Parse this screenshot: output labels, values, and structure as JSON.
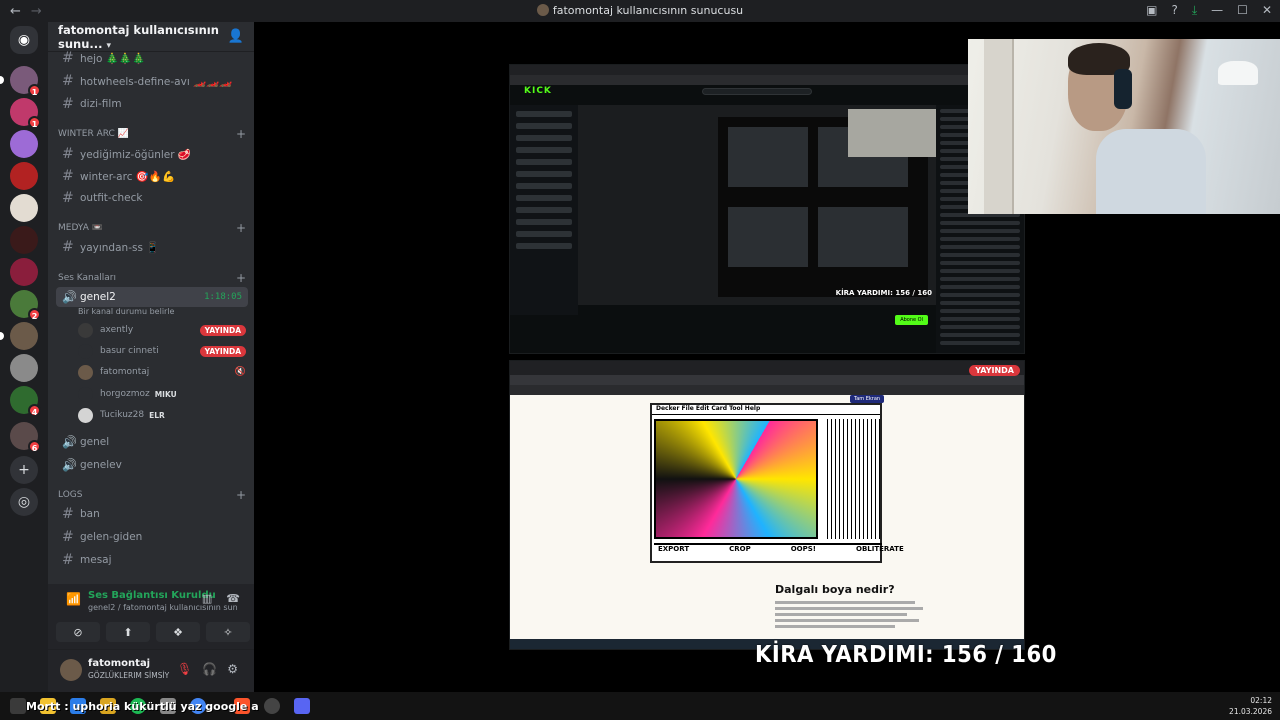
{
  "window": {
    "title": "fatomontaj kullanıcısının sunucusu"
  },
  "guild": {
    "name": "fatomontaj kullanıcısının sunu..."
  },
  "channels_top": [
    {
      "name": "hejo 🎄🎄🎄"
    },
    {
      "name": "hotwheels-define-avı 🏎️🏎️🏎️"
    },
    {
      "name": "dizi-film"
    }
  ],
  "categories": {
    "winter": "WINTER ARC 📈",
    "medya": "MEDYA 📼",
    "ses": "Ses Kanalları",
    "logs": "LOGS"
  },
  "winter_channels": [
    {
      "name": "yediğimiz-öğünler 🥩"
    },
    {
      "name": "winter-arc 🎯🔥💪"
    },
    {
      "name": "outfit-check"
    }
  ],
  "medya_channels": [
    {
      "name": "yayından-ss 📱"
    }
  ],
  "voice": {
    "active_channel": "genel2",
    "status_line": "Bir kanal durumu belirle",
    "timer": "1:18:05",
    "users": [
      {
        "name": "axently",
        "badge": "YAYINDA"
      },
      {
        "name": "basur cinneti",
        "badge": "YAYINDA"
      },
      {
        "name": "fatomontaj"
      },
      {
        "name": "horgozmoz",
        "tag": "MIKU"
      },
      {
        "name": "Tucikuz28",
        "tag": "ELR"
      }
    ],
    "other_channels": [
      {
        "name": "genel"
      },
      {
        "name": "genelev"
      }
    ]
  },
  "logs_channels": [
    {
      "name": "ban"
    },
    {
      "name": "gelen-giden"
    },
    {
      "name": "mesaj"
    }
  ],
  "voice_panel": {
    "title": "Ses Bağlantısı Kuruldu",
    "subtitle": "genel2 / fatomontaj kullanıcısının sunucu..."
  },
  "user_panel": {
    "name": "fatomontaj",
    "status": "GÖZLÜKLERIM SİMSİY"
  },
  "server_badges": [
    "1",
    "1",
    "2",
    "4",
    "6"
  ],
  "stream": {
    "live_badge": "YAYINDA",
    "decker_menu": "Decker  File  Edit  Card  Tool  Help",
    "decker_bottom": [
      "EXPORT",
      "CROP",
      "OOPS!",
      "OBLITERATE"
    ],
    "decker_tag": "Tam Ekran",
    "decker_heading": "Dalgalı boya nedir?",
    "kick_logo": "KICK",
    "kick_kira": "KİRA YARDIMI: 156 / 160",
    "kick_subscribe": "Abone Ol"
  },
  "overlay": {
    "kira": "KİRA YARDIMI:  156 / 160"
  },
  "taskbar": {
    "ticker": "Mortt : uphoria kükürtlü yaz google a",
    "time": "02:12",
    "date": "21.03.2026"
  }
}
